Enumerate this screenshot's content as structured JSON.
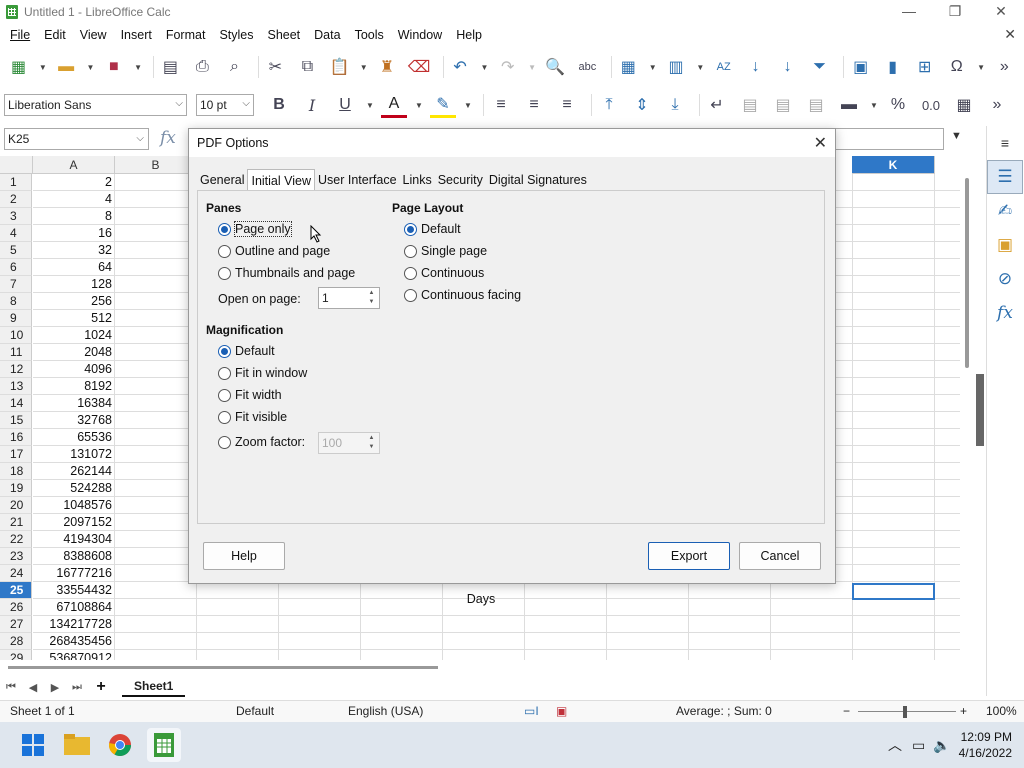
{
  "window": {
    "title": "Untitled 1 - LibreOffice Calc",
    "minimize": "—",
    "restore": "❐",
    "close": "✕"
  },
  "menu": {
    "items": [
      "File",
      "Edit",
      "View",
      "Insert",
      "Format",
      "Styles",
      "Sheet",
      "Data",
      "Tools",
      "Window",
      "Help"
    ],
    "close_doc": "✕"
  },
  "toolbar2": {
    "font_name": "Liberation Sans",
    "font_size": "10 pt"
  },
  "formula": {
    "cell_ref": "K25"
  },
  "sheet": {
    "col_a_header": "A",
    "col_b_header": "B",
    "col_k_header": "K",
    "rows": [
      {
        "n": "1",
        "a": "2"
      },
      {
        "n": "2",
        "a": "4"
      },
      {
        "n": "3",
        "a": "8"
      },
      {
        "n": "4",
        "a": "16"
      },
      {
        "n": "5",
        "a": "32"
      },
      {
        "n": "6",
        "a": "64"
      },
      {
        "n": "7",
        "a": "128"
      },
      {
        "n": "8",
        "a": "256"
      },
      {
        "n": "9",
        "a": "512"
      },
      {
        "n": "10",
        "a": "1024"
      },
      {
        "n": "11",
        "a": "2048"
      },
      {
        "n": "12",
        "a": "4096"
      },
      {
        "n": "13",
        "a": "8192"
      },
      {
        "n": "14",
        "a": "16384"
      },
      {
        "n": "15",
        "a": "32768"
      },
      {
        "n": "16",
        "a": "65536"
      },
      {
        "n": "17",
        "a": "131072"
      },
      {
        "n": "18",
        "a": "262144"
      },
      {
        "n": "19",
        "a": "524288"
      },
      {
        "n": "20",
        "a": "1048576"
      },
      {
        "n": "21",
        "a": "2097152"
      },
      {
        "n": "22",
        "a": "4194304"
      },
      {
        "n": "23",
        "a": "8388608"
      },
      {
        "n": "24",
        "a": "16777216"
      },
      {
        "n": "25",
        "a": "33554432"
      },
      {
        "n": "26",
        "a": "67108864"
      },
      {
        "n": "27",
        "a": "134217728"
      },
      {
        "n": "28",
        "a": "268435456"
      },
      {
        "n": "29",
        "a": "536870912"
      }
    ],
    "selected_row": "25",
    "days_label": "Days",
    "tab_name": "Sheet1"
  },
  "statusbar": {
    "sheet_pos": "Sheet 1 of 1",
    "page_style": "Default",
    "language": "English (USA)",
    "summary": "Average: ; Sum: 0",
    "zoom": "100%"
  },
  "taskbar": {
    "time": "12:09 PM",
    "date": "4/16/2022"
  },
  "dialog": {
    "title": "PDF Options",
    "tabs": [
      "General",
      "Initial View",
      "User Interface",
      "Links",
      "Security",
      "Digital Signatures"
    ],
    "active_tab": "Initial View",
    "panes": {
      "title": "Panes",
      "options": [
        "Page only",
        "Outline and page",
        "Thumbnails and page"
      ],
      "selected": "Page only",
      "open_on_page_label": "Open on page:",
      "open_on_page_value": "1"
    },
    "magnification": {
      "title": "Magnification",
      "options": [
        "Default",
        "Fit in window",
        "Fit width",
        "Fit visible",
        "Zoom factor:"
      ],
      "selected": "Default",
      "zoom_value": "100"
    },
    "page_layout": {
      "title": "Page Layout",
      "options": [
        "Default",
        "Single page",
        "Continuous",
        "Continuous facing"
      ],
      "selected": "Default"
    },
    "buttons": {
      "help": "Help",
      "export": "Export",
      "cancel": "Cancel"
    }
  }
}
